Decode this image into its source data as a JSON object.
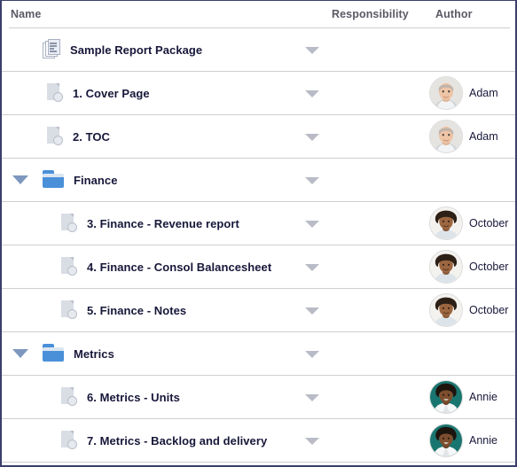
{
  "table": {
    "columns": [
      {
        "key": "name",
        "label": "Name"
      },
      {
        "key": "responsibility",
        "label": "Responsibility"
      },
      {
        "key": "author",
        "label": "Author"
      }
    ],
    "rows": [
      {
        "name": "Sample Report Package",
        "icon": "report-package-icon",
        "indent": 1,
        "twisty": "",
        "responsibility_dropdown": "chevron-down-icon",
        "author": "",
        "avatar": ""
      },
      {
        "name": "1. Cover Page",
        "icon": "document-icon",
        "indent": 2,
        "twisty": "",
        "responsibility_dropdown": "chevron-down-icon",
        "author": "Adam",
        "avatar": "adam"
      },
      {
        "name": "2. TOC",
        "icon": "document-icon",
        "indent": 2,
        "twisty": "",
        "responsibility_dropdown": "chevron-down-icon",
        "author": "Adam",
        "avatar": "adam"
      },
      {
        "name": "Finance",
        "icon": "folder-icon",
        "indent": 1,
        "twisty": "expanded-triangle-icon",
        "responsibility_dropdown": "chevron-down-icon",
        "author": "",
        "avatar": ""
      },
      {
        "name": "3. Finance - Revenue report",
        "icon": "document-icon",
        "indent": 3,
        "twisty": "",
        "responsibility_dropdown": "chevron-down-icon",
        "author": "October",
        "avatar": "october"
      },
      {
        "name": "4. Finance - Consol Balancesheet",
        "icon": "document-icon",
        "indent": 3,
        "twisty": "",
        "responsibility_dropdown": "chevron-down-icon",
        "author": "October",
        "avatar": "october"
      },
      {
        "name": "5. Finance - Notes",
        "icon": "document-icon",
        "indent": 3,
        "twisty": "",
        "responsibility_dropdown": "chevron-down-icon",
        "author": "October",
        "avatar": "october"
      },
      {
        "name": "Metrics",
        "icon": "folder-icon",
        "indent": 1,
        "twisty": "expanded-triangle-icon",
        "responsibility_dropdown": "chevron-down-icon",
        "author": "",
        "avatar": ""
      },
      {
        "name": "6. Metrics - Units",
        "icon": "document-icon",
        "indent": 3,
        "twisty": "",
        "responsibility_dropdown": "chevron-down-icon",
        "author": "Annie",
        "avatar": "annie"
      },
      {
        "name": "7. Metrics - Backlog and delivery",
        "icon": "document-icon",
        "indent": 3,
        "twisty": "",
        "responsibility_dropdown": "chevron-down-icon",
        "author": "Annie",
        "avatar": "annie"
      }
    ]
  },
  "colors": {
    "frame_border": "#3b3f6b",
    "row_divider": "#cfcfcf",
    "header_text": "#5a5a66",
    "row_text": "#17173a",
    "folder_blue": "#4a90d9",
    "twisty_blue": "#7e97bf",
    "chevron_gray": "#b9bcc6",
    "document_gray": "#d9dde4"
  }
}
